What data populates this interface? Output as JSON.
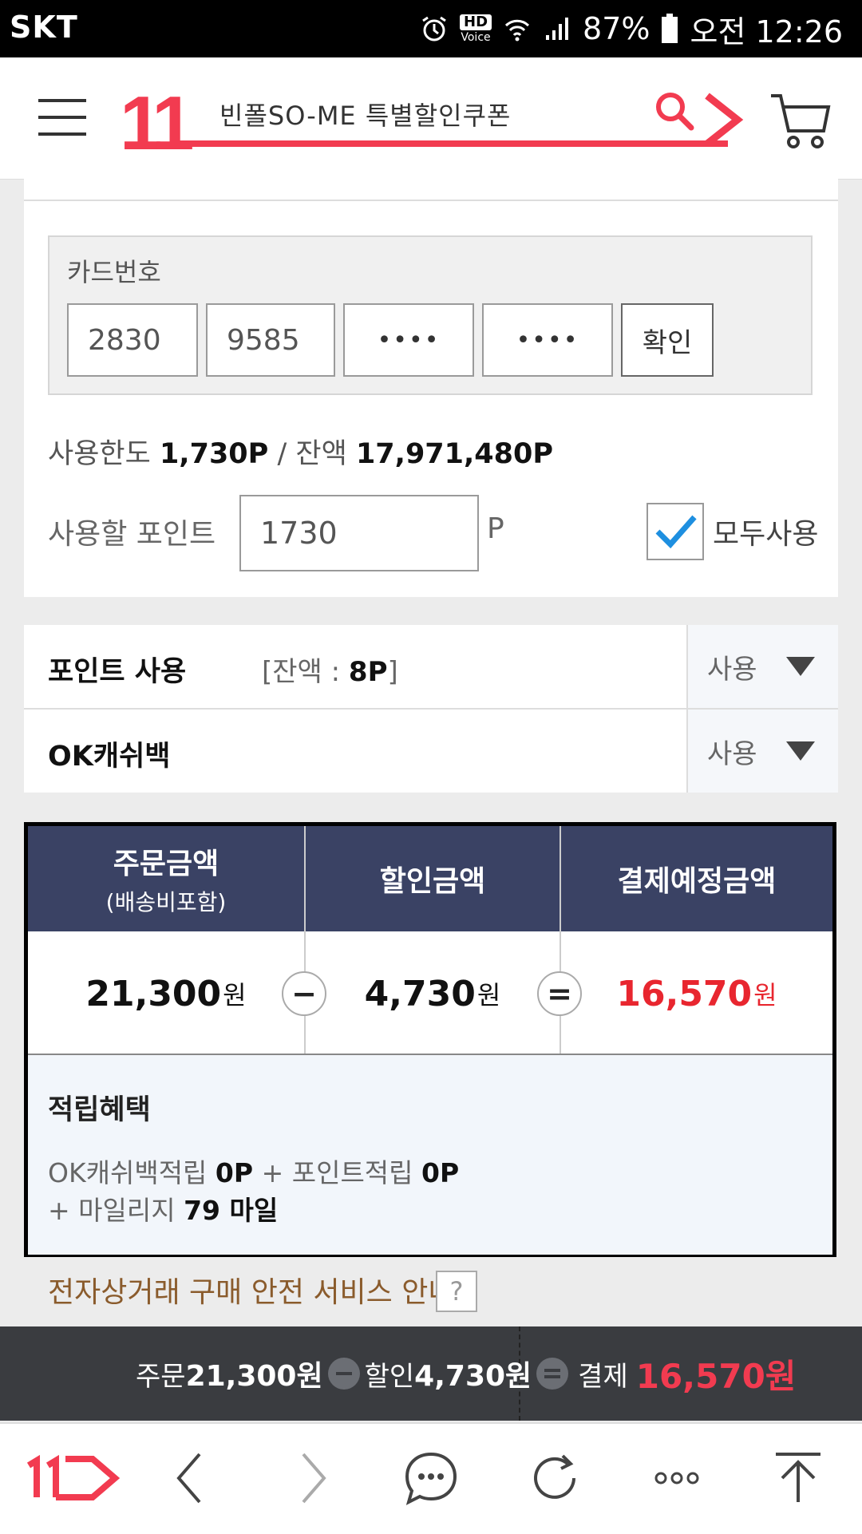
{
  "status_bar": {
    "carrier": "SKT",
    "hd_label": "HD",
    "voice_label": "Voice",
    "battery": "87%",
    "time": "오전 12:26"
  },
  "header": {
    "logo": "11",
    "search_text": "빈폴SO-ME 특별할인쿠폰",
    "icons": [
      "menu-icon",
      "search-icon",
      "cart-icon"
    ]
  },
  "card": {
    "label": "카드번호",
    "fields": [
      "2830",
      "9585",
      "••••",
      "••••"
    ],
    "confirm_label": "확인"
  },
  "points": {
    "limit_label": "사용한도",
    "limit_value": "1,730P",
    "separator": "/",
    "balance_label": "잔액",
    "balance_value": "17,971,480P",
    "use_label": "사용할 포인트",
    "use_value": "1730",
    "unit": "P",
    "use_all_label": "모두사용",
    "use_all_checked": true
  },
  "rows": [
    {
      "title": "포인트 사용",
      "sub_prefix": "[잔액 : ",
      "sub_value": "8P",
      "sub_suffix": "]",
      "select": "사용"
    },
    {
      "title": "OK캐쉬백",
      "select": "사용"
    }
  ],
  "summary": {
    "headers": [
      {
        "label": "주문금액",
        "sub": "(배송비포함)"
      },
      {
        "label": "할인금액",
        "sub": ""
      },
      {
        "label": "결제예정금액",
        "sub": ""
      }
    ],
    "order_amount": "21,300",
    "discount_amount": "4,730",
    "payment_amount": "16,570",
    "currency": "원",
    "minus": "−",
    "equals": "=",
    "benefit_title": "적립혜택",
    "benefit_line1_a": "OK캐쉬백적립",
    "benefit_line1_b": "0P",
    "benefit_line1_c": "+ 포인트적립",
    "benefit_line1_d": "0P",
    "benefit_line2_a": "+ 마일리지",
    "benefit_line2_b": "79 마일"
  },
  "safe_service": {
    "label": "전자상거래 구매 안전 서비스 안내",
    "help": "?"
  },
  "totals_bar": {
    "order_label": "주문",
    "order_value": "21,300원",
    "discount_label": "할인",
    "discount_value": "4,730원",
    "payment_label": "결제",
    "payment_value": "16,570원"
  },
  "browser_bar": {
    "icons": [
      "home-11-icon",
      "back-icon",
      "forward-icon",
      "chat-icon",
      "refresh-icon",
      "more-icon",
      "scroll-top-icon"
    ]
  },
  "colors": {
    "brand_red": "#f23b50",
    "header_navy": "#3a4264",
    "totals_bg": "#3a3c40"
  }
}
